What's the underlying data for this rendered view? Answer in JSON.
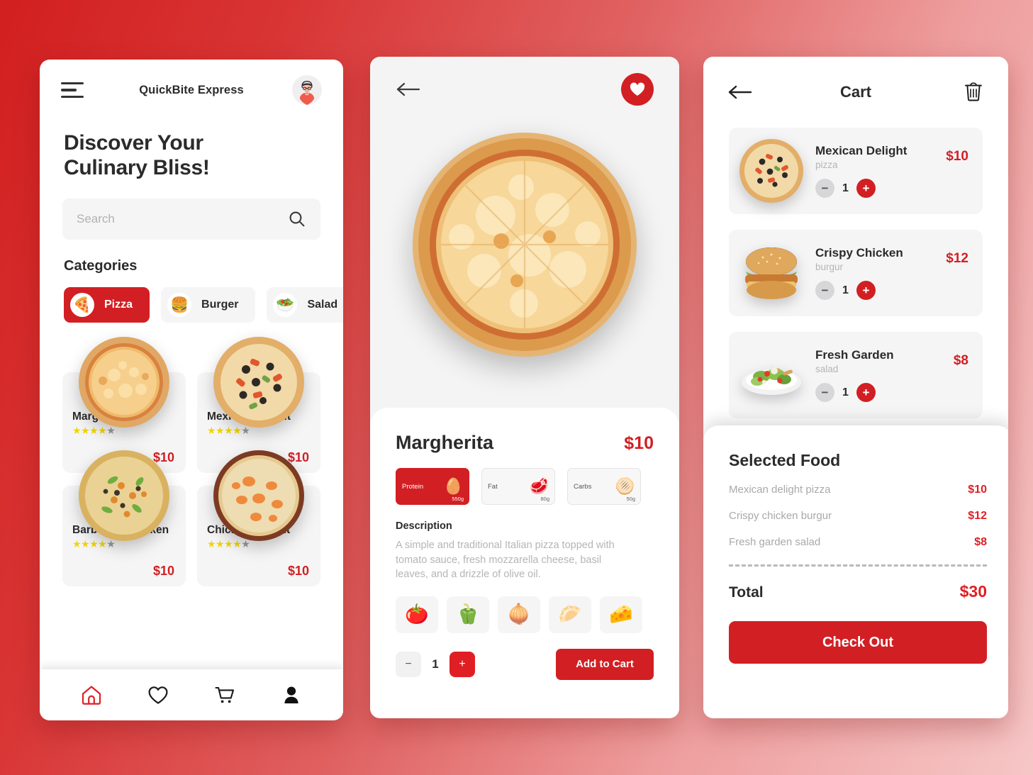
{
  "colors": {
    "accent_red": "#d21f23",
    "bright_red": "#e01f25",
    "text_dark": "#2b2b2b",
    "muted": "#b5b5b7",
    "panel_gray": "#f5f5f6",
    "star_on": "#f1d500",
    "star_off": "#9a9a9a"
  },
  "home": {
    "menu_icon": "hamburger-icon",
    "brand_title": "QuickBite Express",
    "avatar_icon": "user-avatar",
    "hero_line1": "Discover Your",
    "hero_line2": "Culinary Bliss!",
    "search": {
      "placeholder": "Search",
      "value": "",
      "icon": "search-icon"
    },
    "categories_label": "Categories",
    "categories": [
      {
        "label": "Pizza",
        "emoji": "🍕",
        "active": true
      },
      {
        "label": "Burger",
        "emoji": "🍔",
        "active": false
      },
      {
        "label": "Salad",
        "emoji": "🥗",
        "active": false
      }
    ],
    "foods": [
      {
        "name": "Margherita",
        "rating": 4,
        "rating_max": 5,
        "price": "$10"
      },
      {
        "name": "Mexican Delight",
        "rating": 4,
        "rating_max": 5,
        "price": "$10"
      },
      {
        "name": "Barbeque Chicken",
        "rating": 4,
        "rating_max": 5,
        "price": "$10"
      },
      {
        "name": "Chicken Delight",
        "rating": 4,
        "rating_max": 5,
        "price": "$10"
      }
    ],
    "nav": [
      {
        "icon": "home-icon",
        "active": true
      },
      {
        "icon": "heart-icon",
        "active": false
      },
      {
        "icon": "cart-icon",
        "active": false
      },
      {
        "icon": "person-icon",
        "active": false
      }
    ]
  },
  "detail": {
    "back_icon": "back-arrow-icon",
    "favorite_icon": "heart-icon",
    "favorite_active": true,
    "hero_image": "margherita-pizza-photo",
    "name": "Margherita",
    "price": "$10",
    "nutrition": [
      {
        "label": "Protein",
        "grams": "550g",
        "emoji": "🥚",
        "active": true
      },
      {
        "label": "Fat",
        "grams": "80g",
        "emoji": "🥩",
        "active": false
      },
      {
        "label": "Carbs",
        "grams": "50g",
        "emoji": "🫓",
        "active": false
      }
    ],
    "description_label": "Description",
    "description": "A simple and traditional Italian pizza topped with tomato sauce, fresh mozzarella cheese, basil leaves, and a drizzle of olive oil.",
    "ingredients": [
      {
        "name": "tomato",
        "emoji": "🍅"
      },
      {
        "name": "bell-pepper",
        "emoji": "🫑"
      },
      {
        "name": "onion",
        "emoji": "🧅"
      },
      {
        "name": "dough",
        "emoji": "🥟"
      },
      {
        "name": "cheese",
        "emoji": "🧀"
      }
    ],
    "qty_minus": "−",
    "qty_value": "1",
    "qty_plus": "+",
    "add_to_cart": "Add to Cart"
  },
  "cart": {
    "back_icon": "back-arrow-icon",
    "title": "Cart",
    "delete_icon": "trash-icon",
    "items": [
      {
        "name": "Mexican Delight",
        "category": "pizza",
        "price": "$10",
        "qty": "1",
        "image": "mexican-delight-pizza-photo"
      },
      {
        "name": "Crispy Chicken",
        "category": "burgur",
        "price": "$12",
        "qty": "1",
        "image": "crispy-chicken-burger-photo"
      },
      {
        "name": "Fresh Garden",
        "category": "salad",
        "price": "$8",
        "qty": "1",
        "image": "fresh-garden-salad-photo"
      }
    ],
    "qty_minus": "−",
    "qty_plus": "+",
    "selected": {
      "heading": "Selected Food",
      "lines": [
        {
          "name": "Mexican delight pizza",
          "amount": "$10"
        },
        {
          "name": "Crispy chicken burgur",
          "amount": "$12"
        },
        {
          "name": "Fresh garden salad",
          "amount": "$8"
        }
      ],
      "total_label": "Total",
      "total_amount": "$30",
      "checkout_label": "Check Out"
    }
  }
}
